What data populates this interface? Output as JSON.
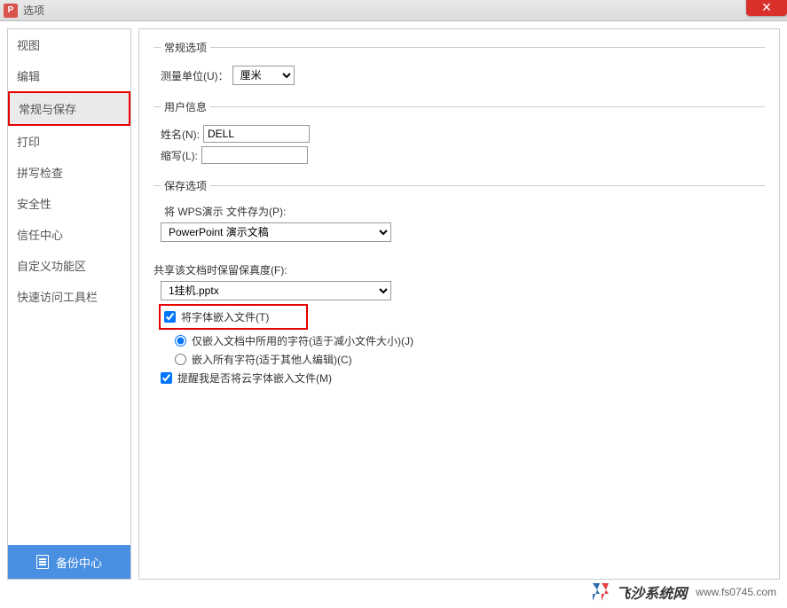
{
  "window": {
    "title": "选项"
  },
  "sidebar": {
    "items": [
      {
        "label": "视图"
      },
      {
        "label": "编辑"
      },
      {
        "label": "常规与保存",
        "selected": true,
        "highlighted": true
      },
      {
        "label": "打印"
      },
      {
        "label": "拼写检查"
      },
      {
        "label": "安全性"
      },
      {
        "label": "信任中心"
      },
      {
        "label": "自定义功能区"
      },
      {
        "label": "快速访问工具栏"
      }
    ],
    "backup_button": "备份中心"
  },
  "sections": {
    "general_options": {
      "legend": "常规选项",
      "measure_label": "测量单位(U)：",
      "measure_value": "厘米"
    },
    "user_info": {
      "legend": "用户信息",
      "name_label": "姓名(N):",
      "name_value": "DELL",
      "abbr_label": "缩写(L):",
      "abbr_value": ""
    },
    "save_options": {
      "legend": "保存选项",
      "save_as_label": "将 WPS演示 文件存为(P):",
      "save_as_value": "PowerPoint 演示文稿",
      "fidelity_label": "共享该文档时保留保真度(F):",
      "fidelity_value": "1挂机.pptx",
      "embed_fonts": "将字体嵌入文件(T)",
      "embed_only_used": "仅嵌入文档中所用的字符(适于减小文件大小)(J)",
      "embed_all": "嵌入所有字符(适于其他人编辑)(C)",
      "remind_cloud": "提醒我是否将云字体嵌入文件(M)"
    }
  },
  "watermark": {
    "text": "飞沙系统网",
    "url": "www.fs0745.com"
  }
}
